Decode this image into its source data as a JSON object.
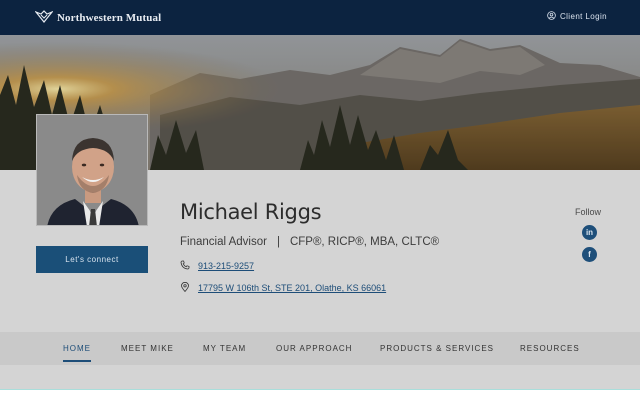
{
  "header": {
    "brand_name": "Northwestern Mutual",
    "client_login_label": "Client Login"
  },
  "hero": {
    "image": "mountain-sunrise-landscape"
  },
  "advisor": {
    "name": "Michael Riggs",
    "role": "Financial Advisor",
    "separator": "|",
    "credentials": "CFP®, RICP®, MBA, CLTC®",
    "phone": "913-215-9257",
    "address": "17795 W 106th St, STE 201, Olathe, KS 66061",
    "connect_label": "Let's connect"
  },
  "social": {
    "follow_label": "Follow",
    "linkedin_glyph": "in",
    "facebook_glyph": "f"
  },
  "nav": {
    "items": [
      {
        "label": "HOME",
        "active": true
      },
      {
        "label": "MEET MIKE",
        "active": false
      },
      {
        "label": "MY TEAM",
        "active": false
      },
      {
        "label": "OUR APPROACH",
        "active": false
      },
      {
        "label": "PRODUCTS & SERVICES",
        "active": false
      },
      {
        "label": "RESOURCES",
        "active": false
      }
    ]
  },
  "colors": {
    "topbar": "#0c2340",
    "accent": "#1d4d78",
    "divider": "#a9dedb"
  }
}
